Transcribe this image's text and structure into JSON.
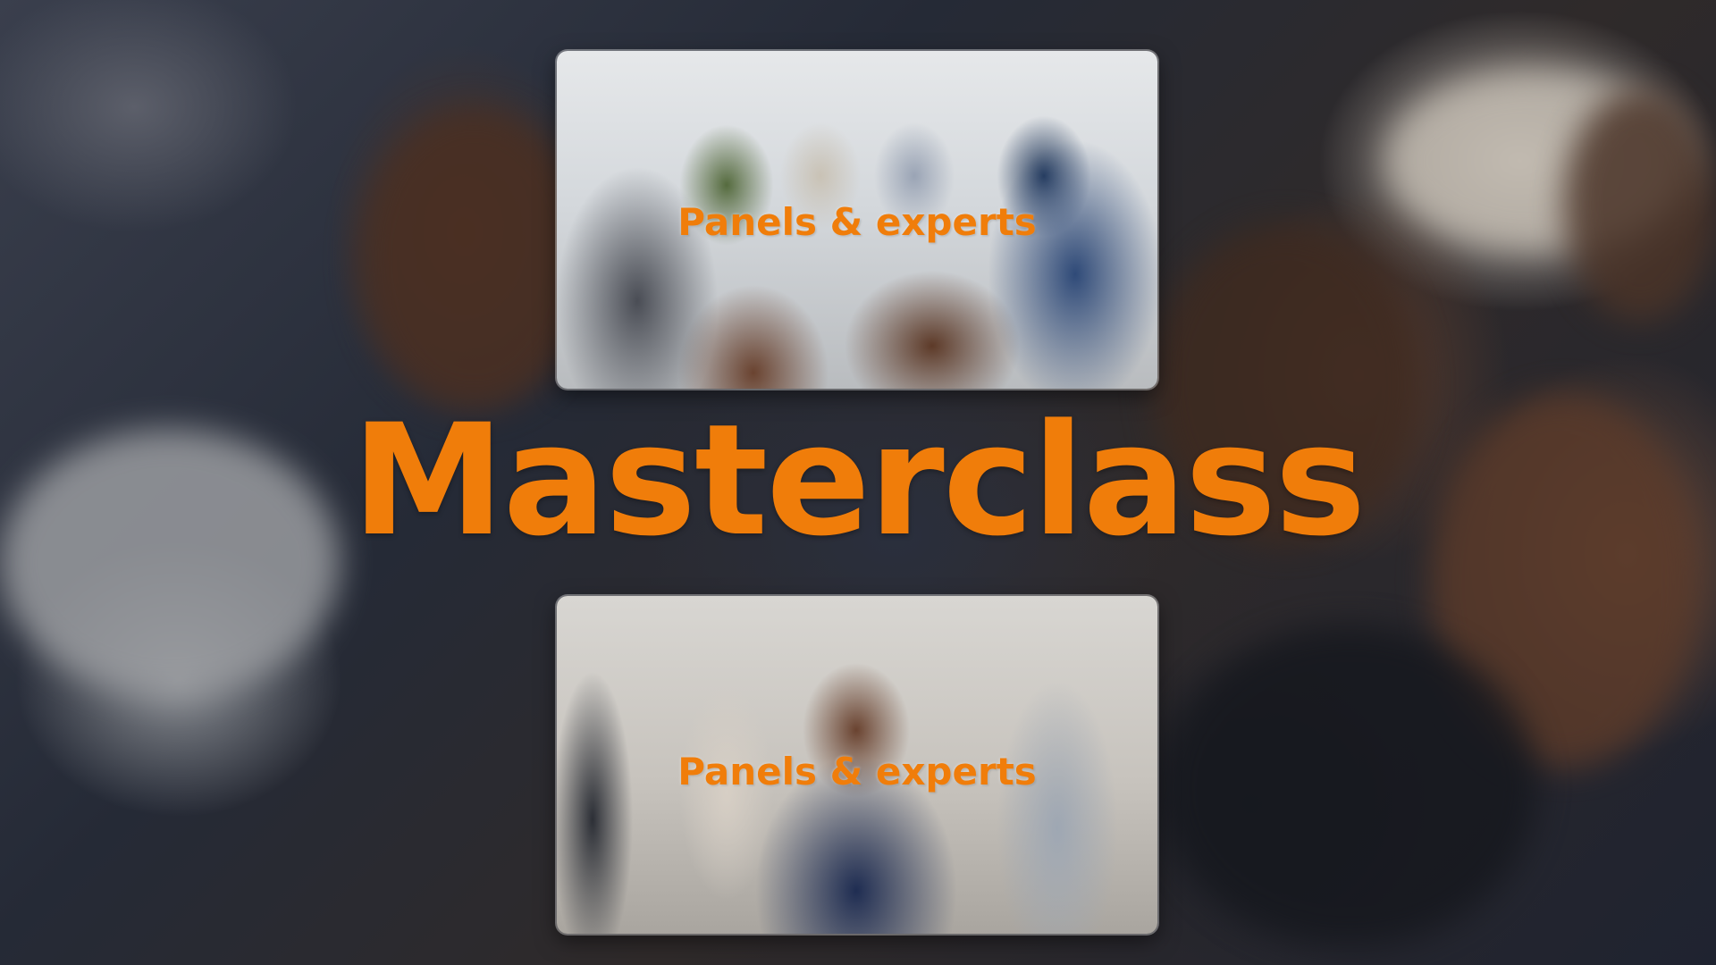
{
  "slide": {
    "headline": "Masterclass",
    "accent_color": "#f07d0a",
    "background_description_icon": "audience-photo",
    "panels": [
      {
        "caption": "Panels & experts",
        "image": "handshake-photo"
      },
      {
        "caption": "Panels & experts",
        "image": "smiling-professional-photo"
      }
    ]
  }
}
